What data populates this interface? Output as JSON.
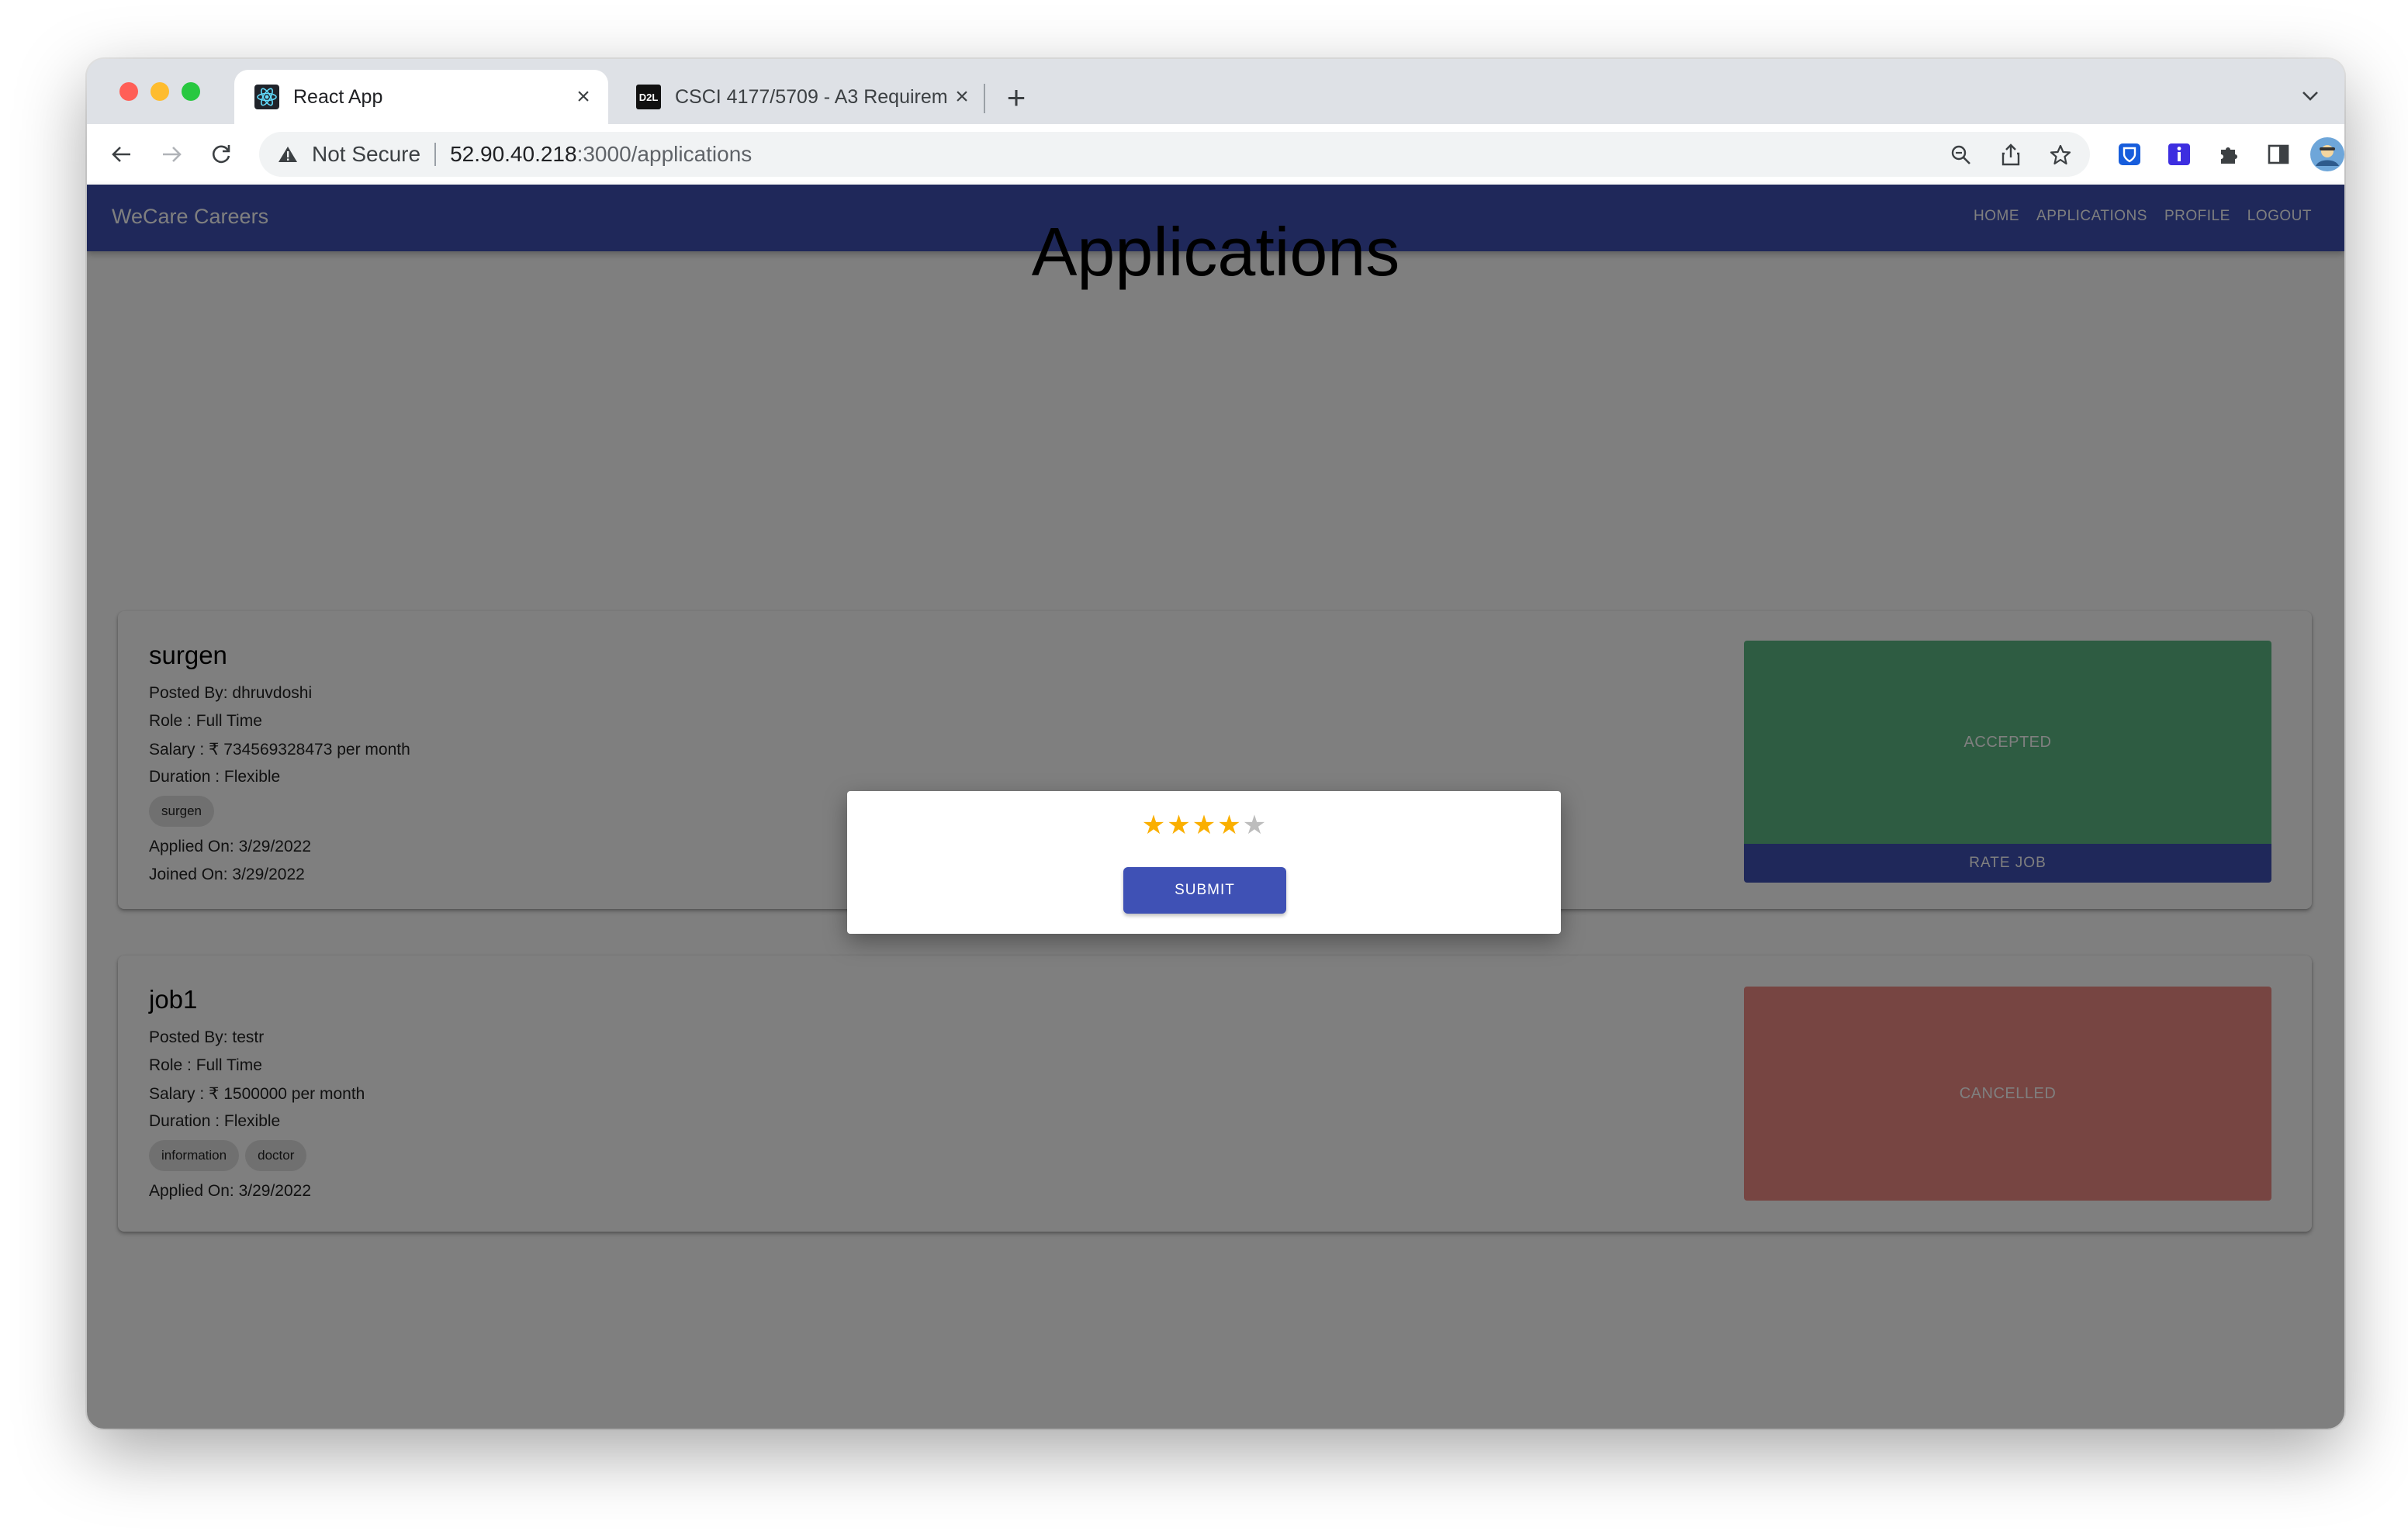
{
  "browser": {
    "tabs": [
      {
        "title": "React App",
        "favicon": "react-icon"
      },
      {
        "title": "CSCI 4177/5709 - A3 Requirem",
        "favicon": "d2l-icon",
        "favicon_text": "D2L"
      }
    ],
    "address": {
      "security_label": "Not Secure",
      "host": "52.90.40.218",
      "path": ":3000/applications"
    }
  },
  "app": {
    "brand": "WeCare Careers",
    "nav": [
      "HOME",
      "APPLICATIONS",
      "PROFILE",
      "LOGOUT"
    ],
    "page_title": "Applications",
    "applications": [
      {
        "title": "surgen",
        "posted_by": "Posted By: dhruvdoshi",
        "role": "Role : Full Time",
        "salary": "Salary : ₹ 734569328473 per month",
        "duration": "Duration : Flexible",
        "skills": [
          "surgen"
        ],
        "applied_on": "Applied On: 3/29/2022",
        "joined_on": "Joined On: 3/29/2022",
        "status": "ACCEPTED",
        "action": "RATE JOB"
      },
      {
        "title": "job1",
        "posted_by": "Posted By: testr",
        "role": "Role : Full Time",
        "salary": "Salary : ₹ 1500000 per month",
        "duration": "Duration : Flexible",
        "skills": [
          "information",
          "doctor"
        ],
        "applied_on": "Applied On: 3/29/2022",
        "status": "CANCELLED"
      }
    ]
  },
  "modal": {
    "rating": 4,
    "max_rating": 5,
    "submit_label": "SUBMIT"
  },
  "colors": {
    "primary": "#3f51b5",
    "accepted": "#5db985",
    "cancelled": "#ef8a85",
    "star_filled": "#faaf00",
    "star_empty": "#bdbdbd"
  }
}
